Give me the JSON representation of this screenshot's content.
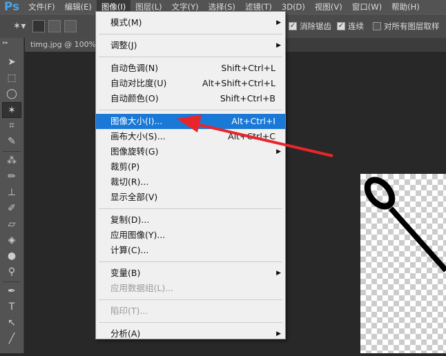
{
  "app": {
    "logo": "Ps"
  },
  "menubar": [
    "文件(F)",
    "编辑(E)",
    "图像(I)",
    "图层(L)",
    "文字(Y)",
    "选择(S)",
    "滤镜(T)",
    "3D(D)",
    "视图(V)",
    "窗口(W)",
    "帮助(H)"
  ],
  "options": {
    "antialias": "消除锯齿",
    "contiguous": "连续",
    "sample_all": "对所有图层取样"
  },
  "document": {
    "tab": "timg.jpg @ 100% (..."
  },
  "menu": {
    "items": [
      {
        "label": "模式(M)",
        "submenu": true
      },
      {
        "sep": true
      },
      {
        "label": "调整(J)",
        "submenu": true
      },
      {
        "sep": true
      },
      {
        "label": "自动色调(N)",
        "shortcut": "Shift+Ctrl+L"
      },
      {
        "label": "自动对比度(U)",
        "shortcut": "Alt+Shift+Ctrl+L"
      },
      {
        "label": "自动颜色(O)",
        "shortcut": "Shift+Ctrl+B"
      },
      {
        "sep": true
      },
      {
        "label": "图像大小(I)...",
        "shortcut": "Alt+Ctrl+I",
        "highlight": true
      },
      {
        "label": "画布大小(S)...",
        "shortcut": "Alt+Ctrl+C"
      },
      {
        "label": "图像旋转(G)",
        "submenu": true
      },
      {
        "label": "裁剪(P)"
      },
      {
        "label": "裁切(R)..."
      },
      {
        "label": "显示全部(V)"
      },
      {
        "sep": true
      },
      {
        "label": "复制(D)..."
      },
      {
        "label": "应用图像(Y)..."
      },
      {
        "label": "计算(C)..."
      },
      {
        "sep": true
      },
      {
        "label": "变量(B)",
        "submenu": true
      },
      {
        "label": "应用数据组(L)...",
        "disabled": true
      },
      {
        "sep": true
      },
      {
        "label": "陷印(T)...",
        "disabled": true
      },
      {
        "sep": true
      },
      {
        "label": "分析(A)",
        "submenu": true
      }
    ]
  },
  "tools": [
    "move-tool",
    "marquee-tool",
    "lasso-tool",
    "magic-wand-tool",
    "crop-tool",
    "eyedropper-tool",
    "healing-tool",
    "brush-tool",
    "stamp-tool",
    "history-brush-tool",
    "eraser-tool",
    "bucket-tool",
    "blur-tool",
    "dodge-tool",
    "pen-tool",
    "type-tool",
    "path-select-tool",
    "line-tool"
  ],
  "colors": {
    "highlight": "#1a78d6",
    "arrow": "#e8262a"
  }
}
